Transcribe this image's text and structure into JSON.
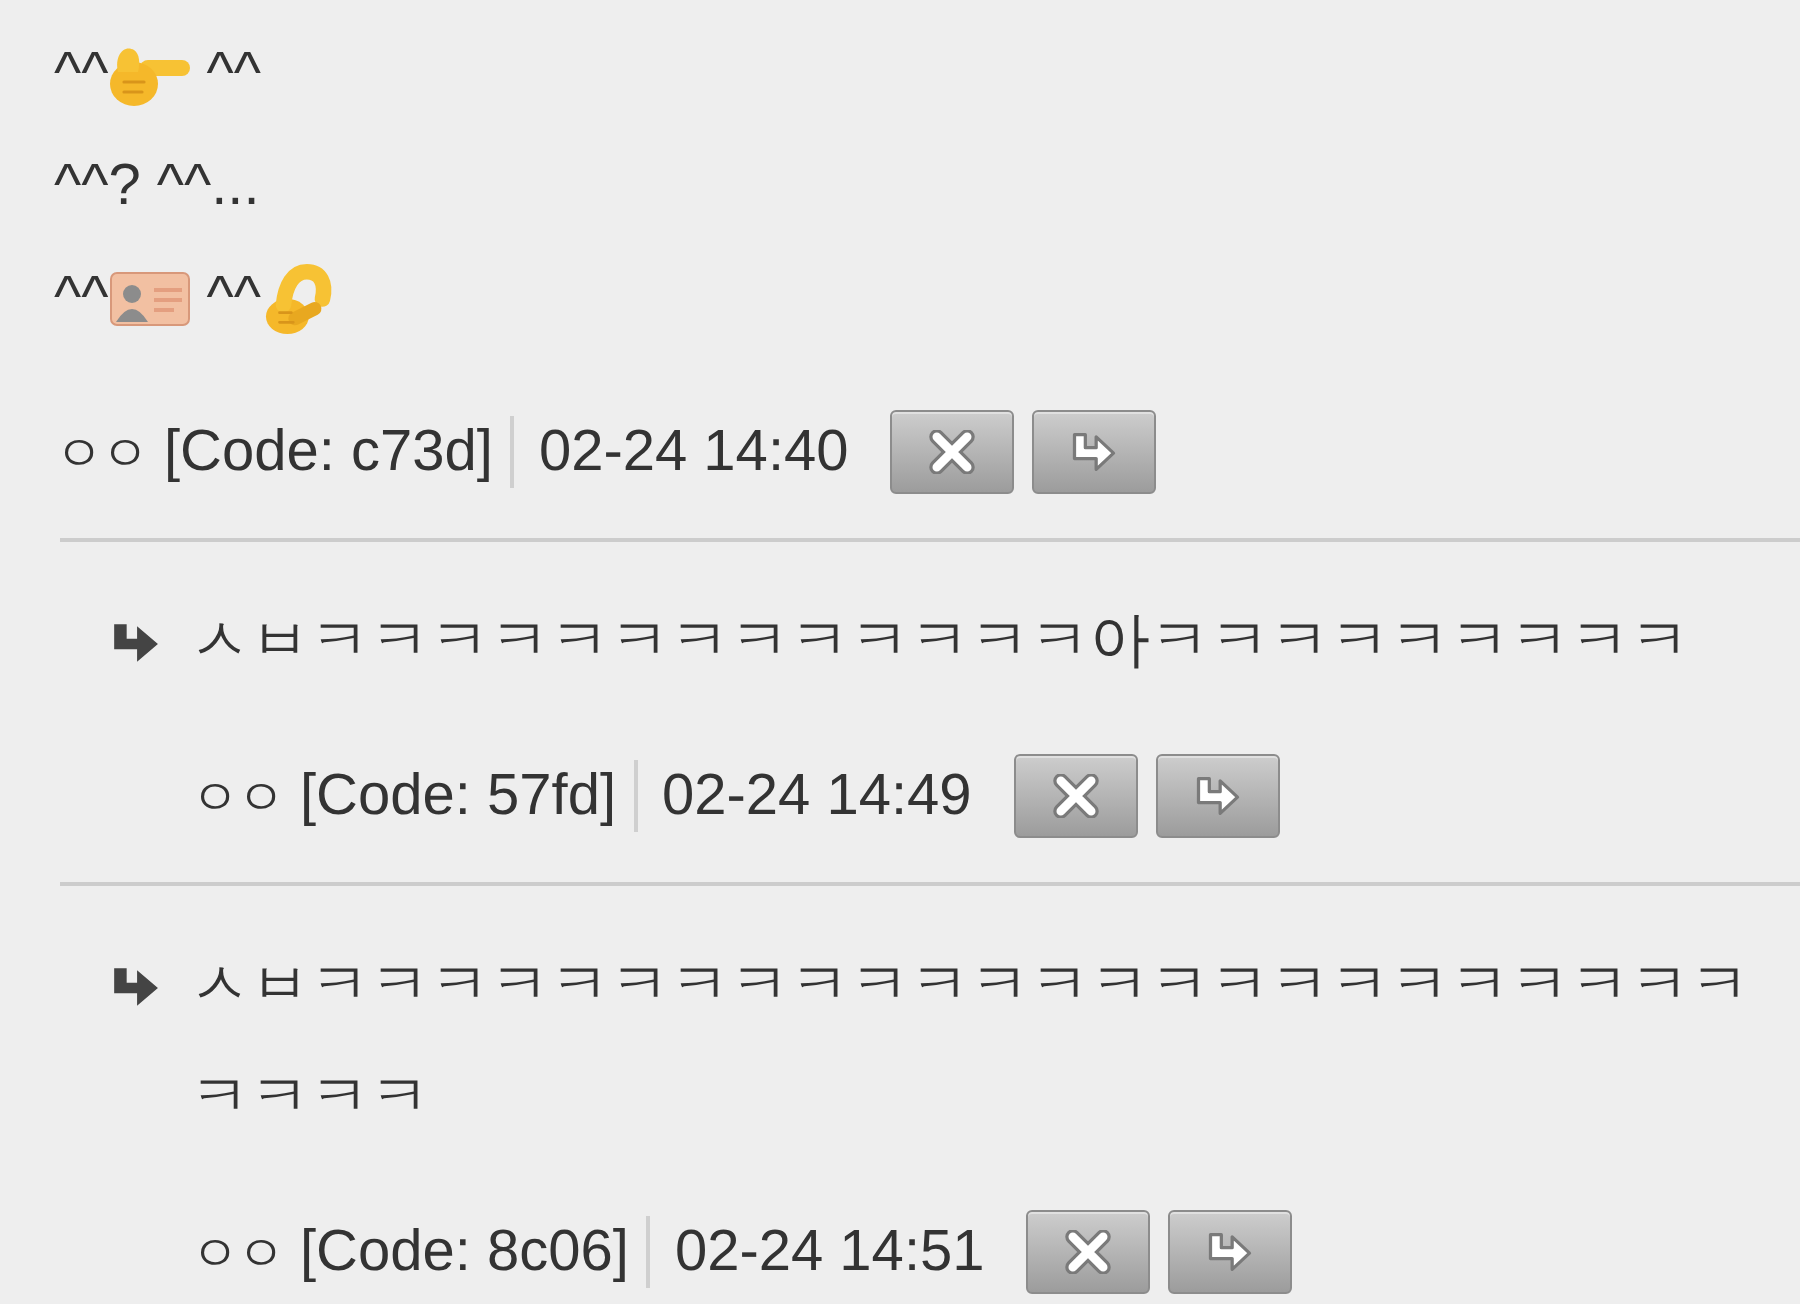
{
  "comment": {
    "lines": [
      [
        {
          "kind": "text",
          "text": "^^"
        },
        {
          "kind": "pointing_hand"
        },
        {
          "kind": "text",
          "text": " ^^"
        }
      ],
      [
        {
          "kind": "text",
          "text": "^^? ^^..."
        }
      ],
      [
        {
          "kind": "text",
          "text": "^^"
        },
        {
          "kind": "id_card"
        },
        {
          "kind": "text",
          "text": " ^^"
        },
        {
          "kind": "pinching_hand"
        }
      ]
    ],
    "author": "ㅇㅇ",
    "code": "[Code: c73d]",
    "time": "02-24 14:40"
  },
  "replies": [
    {
      "text": "ㅅㅂㅋㅋㅋㅋㅋㅋㅋㅋㅋㅋㅋㅋㅋ아ㅋㅋㅋㅋㅋㅋㅋㅋㅋ",
      "author": "ㅇㅇ",
      "code": "[Code: 57fd]",
      "time": "02-24 14:49"
    },
    {
      "text": "ㅅㅂㅋㅋㅋㅋㅋㅋㅋㅋㅋㅋㅋㅋㅋㅋㅋㅋㅋㅋㅋㅋㅋㅋㅋㅋㅋㅋㅋㅋ",
      "author": "ㅇㅇ",
      "code": "[Code: 8c06]",
      "time": "02-24 14:51"
    }
  ]
}
